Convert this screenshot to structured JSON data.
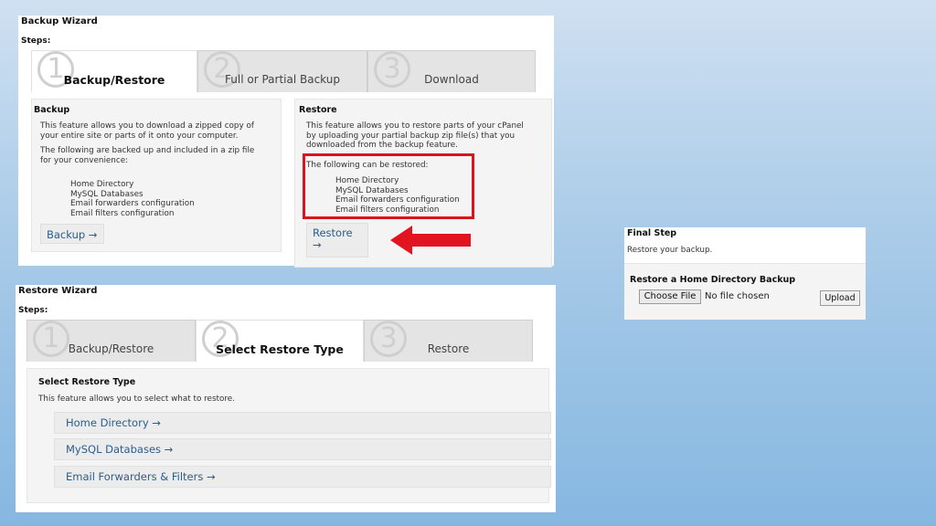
{
  "backup_wizard": {
    "title": "Backup Wizard",
    "steps_label": "Steps:",
    "tabs": [
      {
        "num": "1",
        "label": "Backup/Restore"
      },
      {
        "num": "2",
        "label": "Full or Partial Backup"
      },
      {
        "num": "3",
        "label": "Download"
      }
    ],
    "backup": {
      "heading": "Backup",
      "desc_1": "This feature allows you to download a zipped copy of",
      "desc_2": "your entire site or parts of it onto your computer.",
      "desc_3": "The following are backed up and included in a zip file",
      "desc_4": "for your convenience:",
      "items": [
        "Home Directory",
        "MySQL Databases",
        "Email forwarders configuration",
        "Email filters configuration"
      ],
      "button": "Backup →"
    },
    "restore": {
      "heading": "Restore",
      "desc_1": "This feature allows you to restore parts of your cPanel",
      "desc_2": "by uploading your partial backup zip file(s) that you",
      "desc_3": "downloaded from the backup feature.",
      "list_intro": "The following can be restored:",
      "items": [
        "Home Directory",
        "MySQL Databases",
        "Email forwarders configuration",
        "Email filters configuration"
      ],
      "button_line1": "Restore",
      "button_line2": "→"
    },
    "highlight_color": "#d9141f"
  },
  "restore_wizard": {
    "title": "Restore Wizard",
    "steps_label": "Steps:",
    "tabs": [
      {
        "num": "1",
        "label": "Backup/Restore"
      },
      {
        "num": "2",
        "label": "Select Restore Type"
      },
      {
        "num": "3",
        "label": "Restore"
      }
    ],
    "section_heading": "Select Restore Type",
    "section_desc": "This feature allows you to select what to restore.",
    "options": [
      "Home Directory →",
      "MySQL Databases →",
      "Email Forwarders & Filters →"
    ]
  },
  "final_step": {
    "title": "Final Step",
    "subtitle": "Restore your backup.",
    "section_heading": "Restore a Home Directory Backup",
    "choose_file": "Choose File",
    "file_status": "No file chosen",
    "upload": "Upload"
  }
}
